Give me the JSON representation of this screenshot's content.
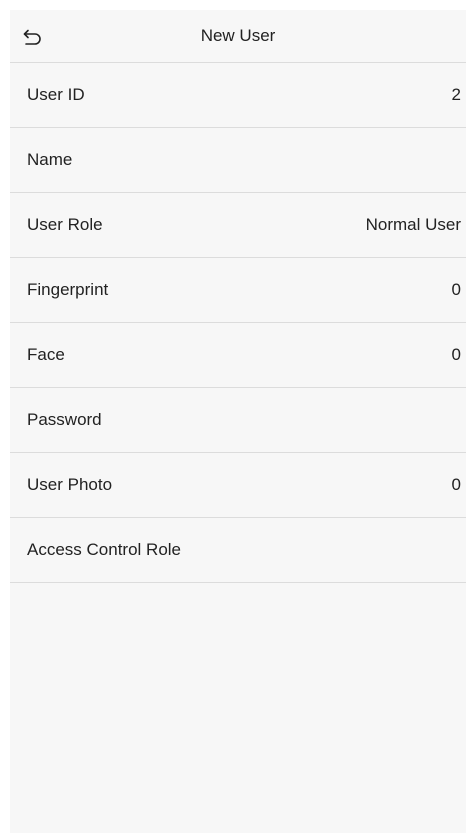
{
  "header": {
    "title": "New User",
    "back_icon": "back-arrow-icon"
  },
  "fields": [
    {
      "label": "User ID",
      "value": "2"
    },
    {
      "label": "Name",
      "value": ""
    },
    {
      "label": "User Role",
      "value": "Normal User"
    },
    {
      "label": "Fingerprint",
      "value": "0"
    },
    {
      "label": "Face",
      "value": "0"
    },
    {
      "label": "Password",
      "value": ""
    },
    {
      "label": "User Photo",
      "value": "0"
    },
    {
      "label": "Access Control Role",
      "value": ""
    }
  ],
  "colors": {
    "background": "#f7f7f7",
    "divider": "#dcdcdc",
    "text": "#222222"
  }
}
